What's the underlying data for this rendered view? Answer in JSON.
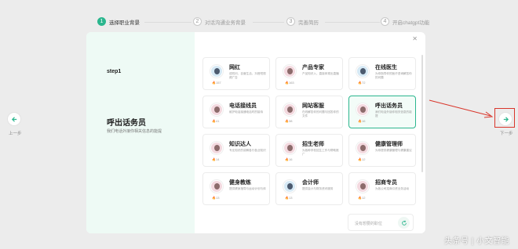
{
  "stepper": {
    "steps": [
      {
        "num": "1",
        "label": "选择职业背景"
      },
      {
        "num": "2",
        "label": "对话沟通业务背景"
      },
      {
        "num": "3",
        "label": "完善简历"
      },
      {
        "num": "4",
        "label": "开启chatgpt功能"
      }
    ]
  },
  "nav": {
    "prev_label": "上一步",
    "next_label": "下一步"
  },
  "left_panel": {
    "step": "step1",
    "role_title": "呼出话务员",
    "role_desc": "我们电话外接你相关信息的能提"
  },
  "cards": [
    {
      "name": "网红",
      "desc": "成机问，自营生活，抖音短视频广告",
      "count": "157",
      "gender": "male"
    },
    {
      "name": "产品专家",
      "desc": "产品知识入，直接体现出直播",
      "count": "163",
      "gender": "female"
    },
    {
      "name": "在线医生",
      "desc": "为你指导你的医疗咨询解答你的问题",
      "count": "72",
      "gender": "male"
    },
    {
      "name": "电话接线员",
      "desc": "维护电话接通电话时的接待",
      "count": "41",
      "gender": "female"
    },
    {
      "name": "网站客服",
      "desc": "在线解答你的问题与回答你的文件",
      "count": "38",
      "gender": "female"
    },
    {
      "name": "呼出话务员",
      "desc": "我们电话外接你相关信息的能提",
      "count": "16",
      "gender": "female",
      "selected": true
    },
    {
      "name": "知识达人",
      "desc": "专业知识的讲解各行各业知识",
      "count": "14",
      "gender": "female"
    },
    {
      "name": "招生老师",
      "desc": "为各种学校招生工作与帮助推广",
      "count": "16",
      "gender": "female"
    },
    {
      "name": "健康管理师",
      "desc": "为你提供健康管理与健康建议",
      "count": "12",
      "gender": "female"
    },
    {
      "name": "健身教练",
      "desc": "提供健身指导与运动计划与体",
      "count": "13",
      "gender": "female"
    },
    {
      "name": "会计师",
      "desc": "提供会计与财务资讯服务",
      "count": "13",
      "gender": "male"
    },
    {
      "name": "招商专员",
      "desc": "为各公司招商引资业务活动",
      "count": "12",
      "gender": "female"
    }
  ],
  "footer": {
    "placeholder": "没有想要的职位"
  },
  "watermark": "头条号 | 小文智能",
  "colors": {
    "accent": "#2bb68e",
    "annotation": "#d9362b"
  }
}
